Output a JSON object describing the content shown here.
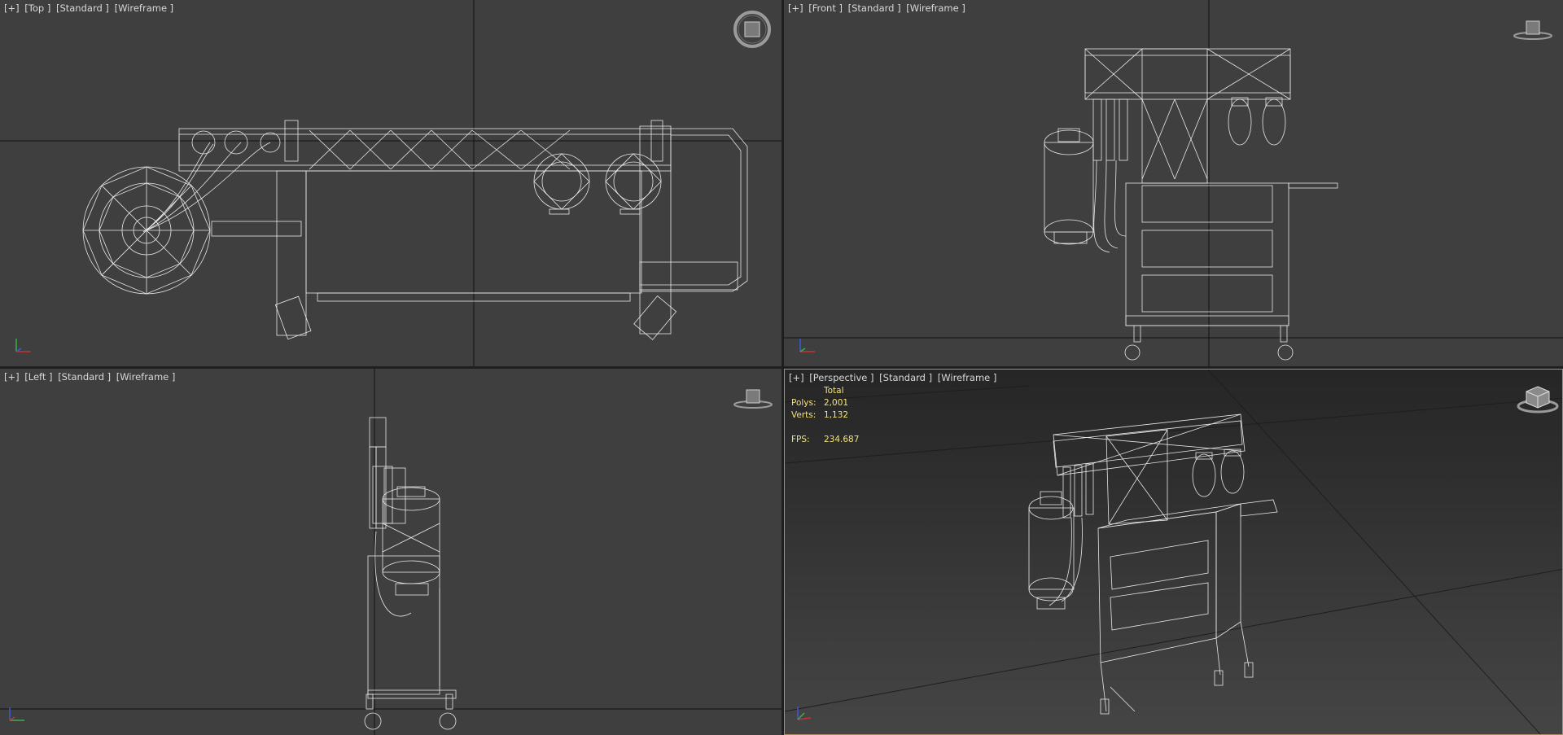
{
  "viewports": {
    "top": {
      "bracket": "[+]",
      "view": "[Top ]",
      "shading": "[Standard ]",
      "mode": "[Wireframe ]"
    },
    "front": {
      "bracket": "[+]",
      "view": "[Front ]",
      "shading": "[Standard ]",
      "mode": "[Wireframe ]"
    },
    "left": {
      "bracket": "[+]",
      "view": "[Left ]",
      "shading": "[Standard ]",
      "mode": "[Wireframe ]"
    },
    "perspective": {
      "bracket": "[+]",
      "view": "[Perspective ]",
      "shading": "[Standard ]",
      "mode": "[Wireframe ]"
    }
  },
  "stats": {
    "header": "Total",
    "polys_label": "Polys:",
    "polys_value": "2,001",
    "verts_label": "Verts:",
    "verts_value": "1,132",
    "fps_label": "FPS:",
    "fps_value": "234.687"
  },
  "icons": {
    "viewcube": "viewcube-icon",
    "axis_gizmo": "axis-gizmo-icon"
  },
  "colors": {
    "viewport_bg": "#3f3f3f",
    "active_border": "#a8925a",
    "stats_text": "#f2e27a",
    "wire": "#e8e8e8"
  }
}
